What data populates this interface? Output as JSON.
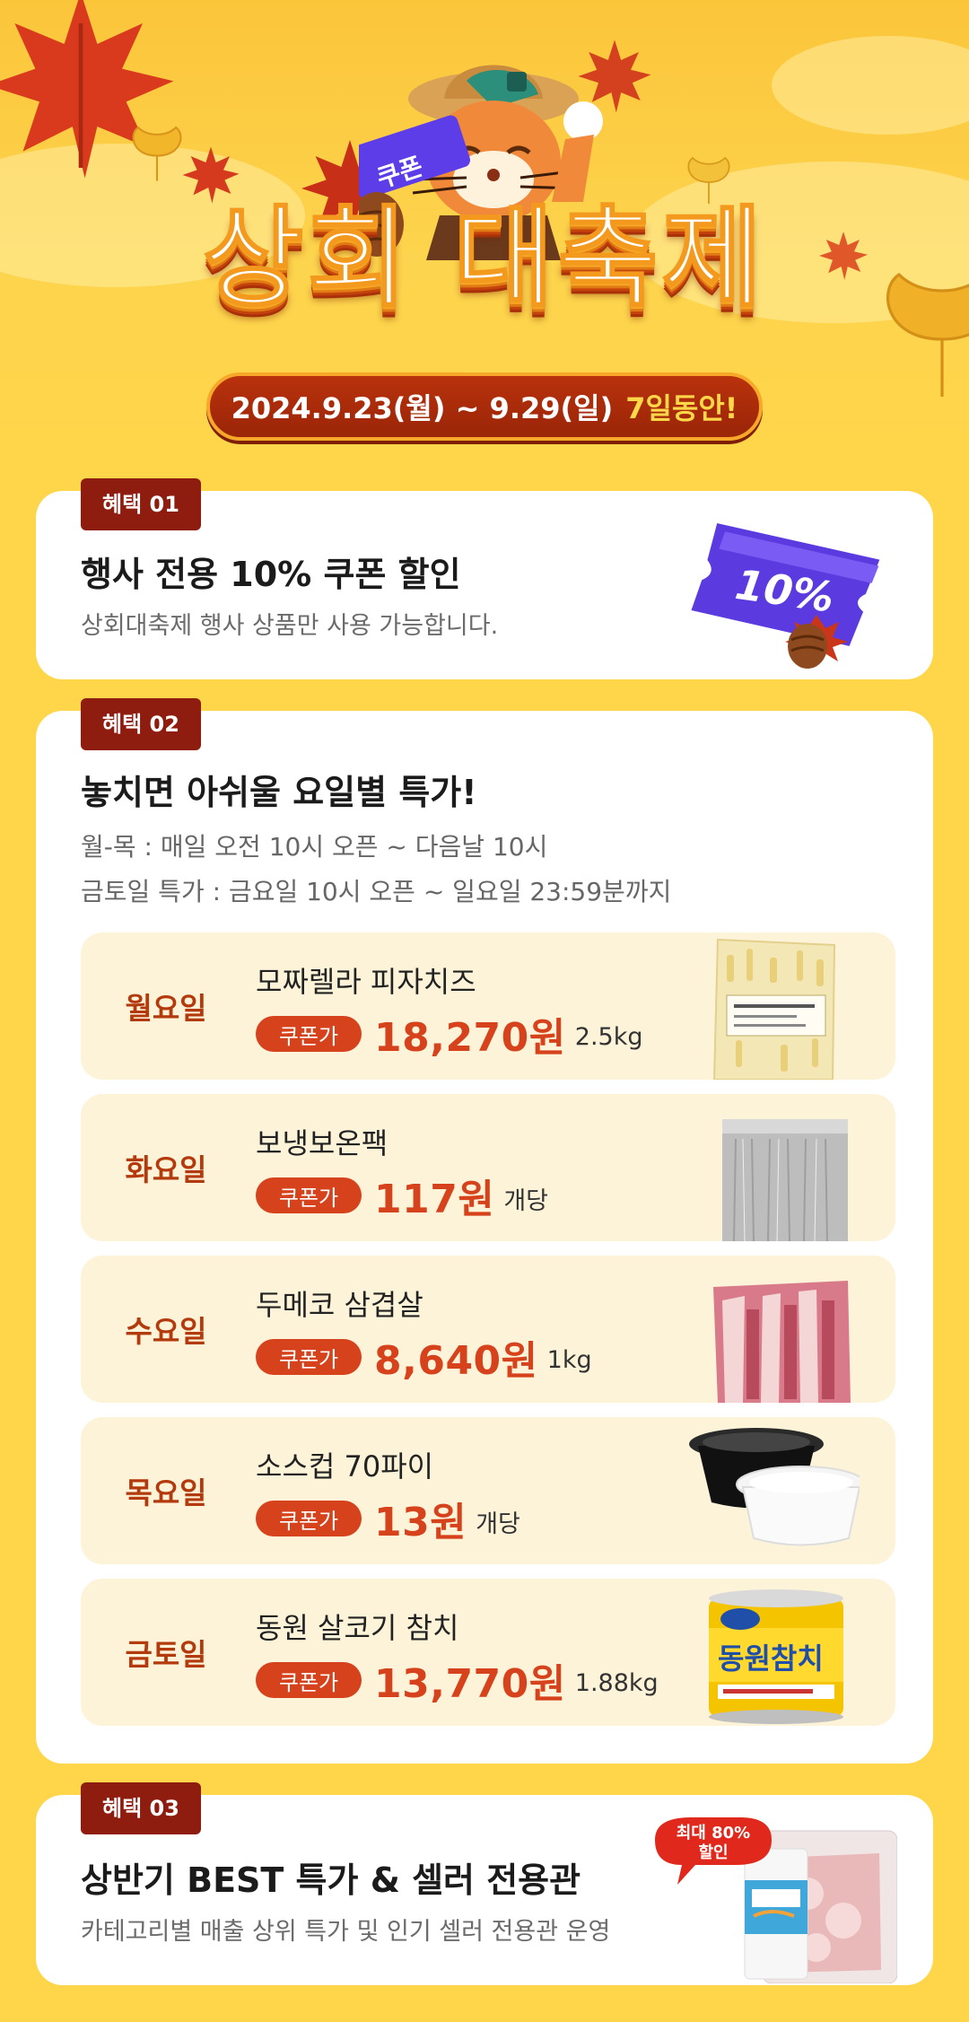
{
  "hero": {
    "title": "상회 대축제",
    "mascot_badge": "쿠폰",
    "date_range": "2024.9.23(월) ~ 9.29(일)",
    "date_highlight": "7일동안!"
  },
  "colors": {
    "background": "#FFD54A",
    "accent_red": "#D6421C",
    "tag_bg": "#8E1D0F",
    "day_text": "#B33A0D",
    "deal_bg": "#FDF3D8"
  },
  "benefit1": {
    "tag": "혜택 01",
    "title": "행사 전용 10% 쿠폰 할인",
    "subtitle": "상회대축제 행사 상품만 사용 가능합니다.",
    "ticket_text": "10%"
  },
  "benefit2": {
    "tag": "혜택 02",
    "title": "놓치면 아쉬울 요일별 특가!",
    "schedule": [
      "월-목 : 매일 오전 10시 오픈 ~ 다음날 10시",
      "금토일 특가 : 금요일 10시 오픈 ~ 일요일 23:59분까지"
    ],
    "deals": [
      {
        "day": "월요일",
        "name": "모짜렐라 피자치즈",
        "badge": "쿠폰가",
        "price": "18,270원",
        "unit": "2.5kg",
        "image": "cheese-bag-icon"
      },
      {
        "day": "화요일",
        "name": "보냉보온팩",
        "badge": "쿠폰가",
        "price": "117원",
        "unit": "개당",
        "image": "insulated-pack-icon"
      },
      {
        "day": "수요일",
        "name": "두메코 삼겹살",
        "badge": "쿠폰가",
        "price": "8,640원",
        "unit": "1kg",
        "image": "pork-belly-icon"
      },
      {
        "day": "목요일",
        "name": "소스컵 70파이",
        "badge": "쿠폰가",
        "price": "13원",
        "unit": "개당",
        "image": "sauce-cup-icon"
      },
      {
        "day": "금토일",
        "name": "동원 살코기 참치",
        "badge": "쿠폰가",
        "price": "13,770원",
        "unit": "1.88kg",
        "image": "tuna-can-icon"
      }
    ],
    "tuna_label": "동원참치"
  },
  "benefit3": {
    "tag": "혜택 03",
    "title": "상반기 BEST 특가 & 셀러 전용관",
    "subtitle": "카테고리별 매출 상위 특가 및 인기 셀러 전용관 운영",
    "bubble_line1": "최대 80%",
    "bubble_line2": "할인"
  }
}
